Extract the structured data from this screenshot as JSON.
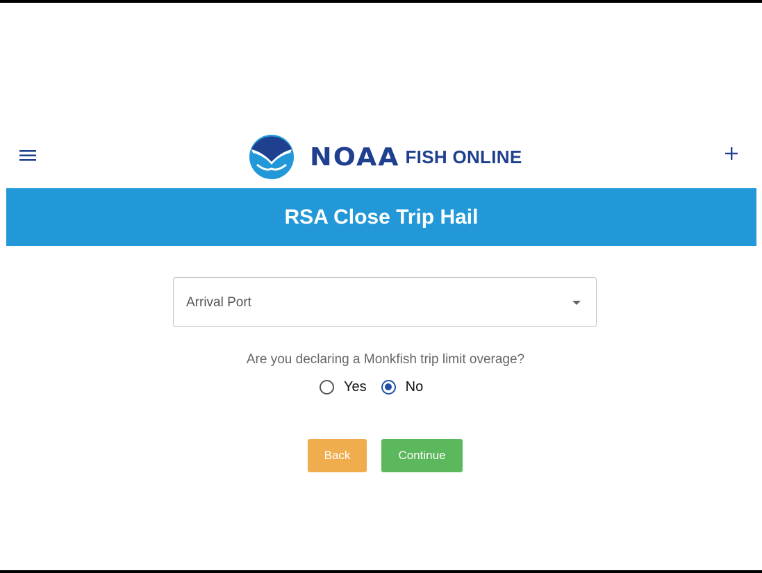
{
  "header": {
    "menu_icon": "hamburger-menu-icon",
    "add_icon": "plus-icon",
    "logo": {
      "emblem": "noaa-emblem-icon",
      "wordmark": "NOAA",
      "subtitle": "FISH ONLINE"
    },
    "colors": {
      "brand_navy": "#1f3f8f",
      "brand_blue": "#2398d8"
    }
  },
  "banner": {
    "title": "RSA Close Trip Hail",
    "color": "#2398d8"
  },
  "form": {
    "arrival_port": {
      "label": "Arrival Port",
      "value": "",
      "icon": "dropdown-caret-icon"
    },
    "monkfish_question": {
      "text": "Are you declaring a Monkfish trip limit overage?",
      "options": [
        {
          "label": "Yes",
          "selected": false
        },
        {
          "label": "No",
          "selected": true
        }
      ]
    }
  },
  "actions": {
    "back_label": "Back",
    "back_color": "#f0ad4e",
    "continue_label": "Continue",
    "continue_color": "#5cb85c"
  }
}
